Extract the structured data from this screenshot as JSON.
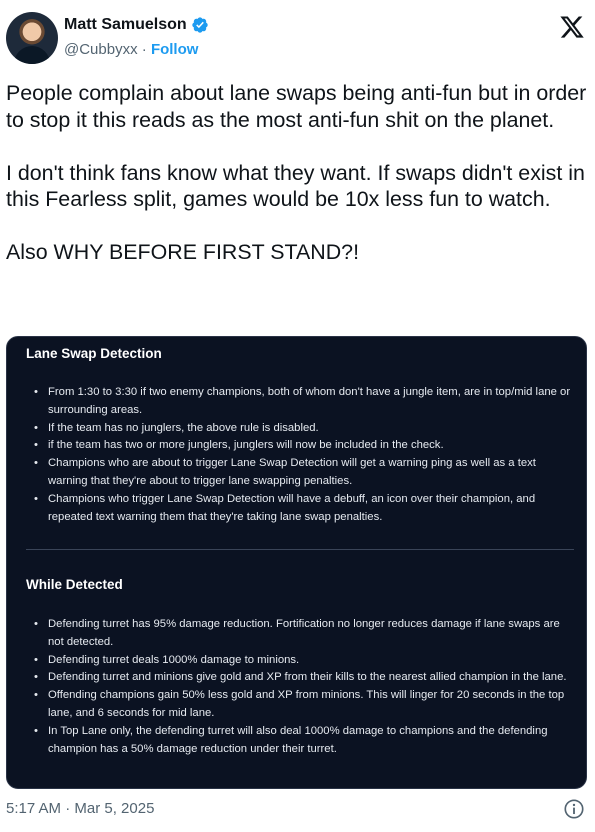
{
  "author": {
    "name": "Matt Samuelson",
    "handle": "@Cubbyxx",
    "separator": "·",
    "follow_label": "Follow"
  },
  "icons": {
    "verified": "verified-badge-icon",
    "platform": "x-logo-icon",
    "info": "info-icon",
    "verified_color": "#1d9bf0"
  },
  "tweet": {
    "paragraphs": [
      "People complain about lane swaps being anti-fun but in order to stop it this reads as the most anti-fun shit on the planet.",
      "I don't think fans know what they want. If swaps didn't exist in this Fearless split, games would be 10x less fun to watch.",
      "Also WHY BEFORE FIRST STAND?!"
    ]
  },
  "media": {
    "background": "#0b1222",
    "section1": {
      "title": "Lane Swap Detection",
      "items": [
        "From 1:30 to 3:30 if two enemy champions, both of whom don't have a jungle item, are in top/mid lane or surrounding areas.",
        "If the team has no junglers, the above rule is disabled.",
        "if the team has two or more junglers, junglers will now be included in the check.",
        "Champions who are about to trigger Lane Swap Detection will get a warning ping as well as a text warning that they're about to trigger lane swapping penalties.",
        "Champions who trigger Lane Swap Detection will have a debuff, an icon over their champion, and repeated text warning them that they're taking lane swap penalties."
      ]
    },
    "section2": {
      "title": "While Detected",
      "items": [
        "Defending turret has 95% damage reduction. Fortification no longer reduces damage if lane swaps are not detected.",
        "Defending turret deals 1000% damage to minions.",
        "Defending turret and minions give gold and XP from their kills to the nearest allied champion in the lane.",
        "Offending champions gain 50% less gold and XP from minions. This will linger for 20 seconds in the top lane, and 6 seconds for mid lane.",
        "In Top Lane only, the defending turret will also deal 1000% damage to champions and the defending champion has a 50% damage reduction under their turret."
      ]
    }
  },
  "footer": {
    "timestamp": "5:17 AM · Mar 5, 2025"
  }
}
